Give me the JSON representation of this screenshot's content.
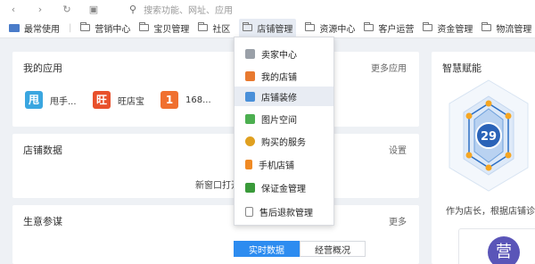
{
  "topbar": {
    "search_placeholder": "搜索功能、网址、应用"
  },
  "bookmarks": [
    {
      "label": "最常使用"
    },
    {
      "label": "营销中心"
    },
    {
      "label": "宝贝管理"
    },
    {
      "label": "社区"
    },
    {
      "label": "店铺管理"
    },
    {
      "label": "资源中心"
    },
    {
      "label": "客户运营"
    },
    {
      "label": "资金管理"
    },
    {
      "label": "物流管理"
    }
  ],
  "my_apps": {
    "title": "我的应用",
    "more": "更多应用",
    "items": [
      {
        "label": "甩手...",
        "icon_char": "甩",
        "color": "#3aa6e0"
      },
      {
        "label": "旺店宝",
        "icon_char": "旺",
        "color": "#e8502b"
      },
      {
        "label": "168...",
        "icon_char": "1",
        "color": "#f07030"
      }
    ]
  },
  "shop_data": {
    "title": "店铺数据",
    "settings": "设置",
    "notice": "新窗口打开"
  },
  "business": {
    "title": "生意参谋",
    "more": "更多",
    "tab_active": "实时数据",
    "tab_other": "经营概况"
  },
  "smart": {
    "title": "智慧赋能",
    "score": "29",
    "desc": "作为店长，根据店铺诊",
    "avatar_char": "营"
  },
  "dropdown": {
    "items": [
      {
        "label": "卖家中心",
        "icon": "seller-center-icon",
        "color": "#9aa0a8"
      },
      {
        "label": "我的店铺",
        "icon": "my-shop-icon",
        "color": "#e87a30"
      },
      {
        "label": "店铺装修",
        "icon": "shop-decoration-icon",
        "color": "#4a90d9"
      },
      {
        "label": "图片空间",
        "icon": "image-space-icon",
        "color": "#4caf50"
      },
      {
        "label": "购买的服务",
        "icon": "purchased-service-icon",
        "color": "#e0a020"
      },
      {
        "label": "手机店铺",
        "icon": "mobile-shop-icon",
        "color": "#f08a24"
      },
      {
        "label": "保证金管理",
        "icon": "deposit-icon",
        "color": "#3a9a3a"
      },
      {
        "label": "售后退款管理",
        "icon": "refund-doc-icon",
        "color": "#888888"
      }
    ]
  }
}
